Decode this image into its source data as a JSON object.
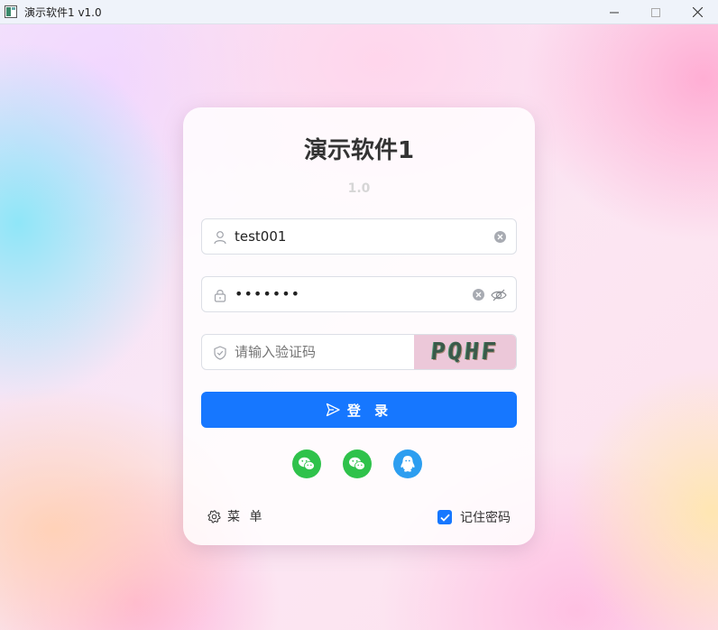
{
  "window": {
    "title": "演示软件1 v1.0",
    "minimize_icon": "minimize-icon",
    "maximize_icon": "maximize-icon",
    "close_icon": "close-icon"
  },
  "login": {
    "title": "演示软件1",
    "version": "1.0",
    "username": {
      "value": "test001",
      "icon": "user-icon"
    },
    "password": {
      "value": "•••••••",
      "icon": "lock-icon"
    },
    "captcha": {
      "placeholder": "请输入验证码",
      "image_text": "PQHF",
      "icon": "shield-icon"
    },
    "submit_label": "登 录",
    "social_logins": [
      "wechat-icon",
      "wechat-icon",
      "qq-icon"
    ],
    "menu_label": "菜 单",
    "remember_label": "记住密码",
    "remember_checked": true
  },
  "colors": {
    "accent": "#1677ff",
    "wechat": "#2fc24b",
    "qq": "#2d9ef0"
  }
}
